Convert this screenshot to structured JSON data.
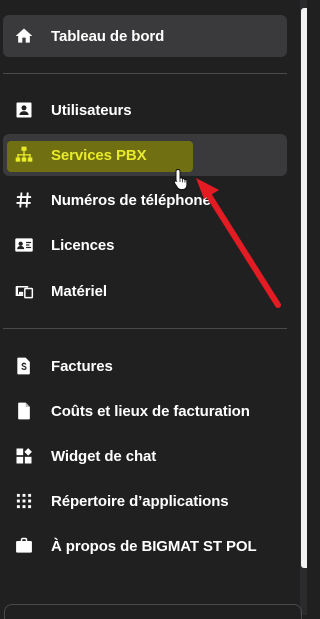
{
  "menu": {
    "dashboard": {
      "label": "Tableau de bord",
      "icon": "home-icon"
    },
    "users": {
      "label": "Utilisateurs",
      "icon": "contact-card-icon"
    },
    "pbx": {
      "label": "Services PBX",
      "icon": "sitemap-icon"
    },
    "phone_numbers": {
      "label": "Numéros de téléphone",
      "icon": "hash-icon"
    },
    "licences": {
      "label": "Licences",
      "icon": "id-card-icon"
    },
    "hardware": {
      "label": "Matériel",
      "icon": "devices-icon"
    },
    "invoices": {
      "label": "Factures",
      "icon": "invoice-dollar-icon"
    },
    "billing_costs": {
      "label": "Coûts et lieux de facturation",
      "icon": "document-icon"
    },
    "chat_widget": {
      "label": "Widget de chat",
      "icon": "widgets-icon"
    },
    "app_directory": {
      "label": "Répertoire d’applications",
      "icon": "grid-dots-icon"
    },
    "about": {
      "label": "À propos de BIGMAT ST POL",
      "icon": "briefcase-icon"
    }
  },
  "colors": {
    "background": "#202021",
    "active_item": "#3a3a3c",
    "highlight_text": "#e8ea2a",
    "highlight_bg": "#7d7d0a",
    "arrow": "#e31b23"
  }
}
